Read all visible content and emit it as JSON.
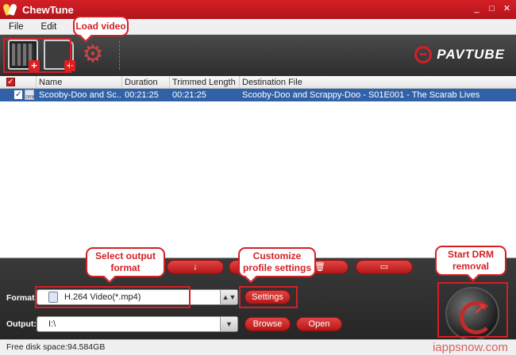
{
  "window": {
    "title": "ChewTune",
    "controls": [
      "_",
      "□",
      "✕"
    ]
  },
  "menu": [
    "File",
    "Edit",
    "To"
  ],
  "toolbar": {
    "brand": "PAVTUBE"
  },
  "table": {
    "columns": [
      "Name",
      "Duration",
      "Trimmed Length",
      "Destination File"
    ],
    "rows": [
      {
        "name": "Scooby-Doo and Sc...",
        "duration": "00:21:25",
        "trimmed": "00:21:25",
        "destination": "Scooby-Doo and Scrappy-Doo - S01E001 - The Scarab Lives",
        "icon_text": "DRM"
      }
    ]
  },
  "bottom": {
    "format_label": "Format:",
    "format_value": "H.264 Video(*.mp4)",
    "settings_label": "Settings",
    "output_label": "Output:",
    "output_value": "I:\\",
    "browse_label": "Browse",
    "open_label": "Open",
    "action_icons": [
      "↓",
      "",
      "🗑",
      "▭"
    ]
  },
  "status": {
    "free_space": "Free disk space:94.584GB",
    "watermark": "iappsnow.com"
  },
  "annotations": {
    "load_video": "Load video",
    "select_format": "Select output format",
    "customize": "Customize profile settings",
    "start": "Start DRM removal"
  },
  "colors": {
    "accent": "#d41f26",
    "selection": "#3162a8"
  }
}
